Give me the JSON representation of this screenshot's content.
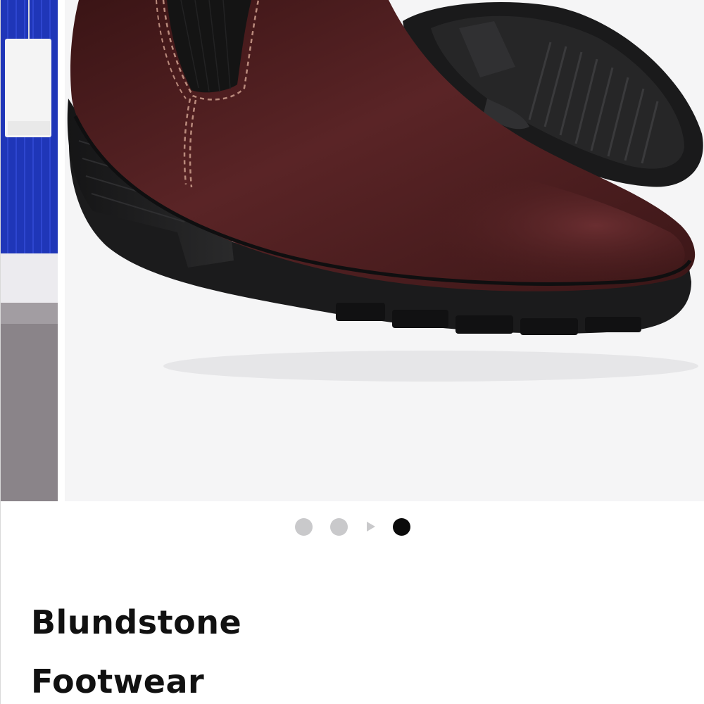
{
  "product": {
    "brand_line1": "Blundstone",
    "brand_line2": "Footwear",
    "image_alt": "Burgundy leather Chelsea heeled ankle boot"
  },
  "carousel": {
    "slide_count": 4,
    "active_index": 3,
    "icons": {
      "next": "play-arrow-icon"
    }
  },
  "colors": {
    "boot_leather": "#4b1d1e",
    "sole": "#1c1c1d",
    "elastic": "#161616",
    "stitching": "#b98a7c",
    "dot_inactive": "#c9c9cb",
    "dot_active": "#0b0b0b",
    "title_text": "#111111"
  }
}
